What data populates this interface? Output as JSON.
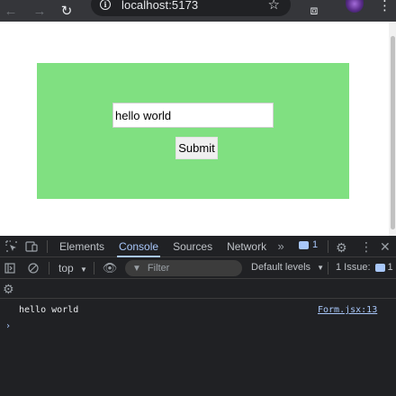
{
  "browser": {
    "url": "localhost:5173",
    "nav": {
      "back_icon": "back-arrow-icon",
      "forward_icon": "forward-arrow-icon",
      "reload_icon": "reload-icon"
    }
  },
  "page": {
    "form": {
      "input_value": "hello world",
      "submit_label": "Submit",
      "background_color": "#80e081"
    }
  },
  "devtools": {
    "tabs": [
      "Elements",
      "Console",
      "Sources",
      "Network"
    ],
    "active_tab": "Console",
    "message_count": "1",
    "toolbar": {
      "context": "top",
      "filter_placeholder": "Filter",
      "levels": "Default levels",
      "issues_label": "1 Issue:",
      "issues_count": "1"
    },
    "console": {
      "log_text": "hello world",
      "log_source": "Form.jsx:13",
      "prompt": "›"
    }
  }
}
